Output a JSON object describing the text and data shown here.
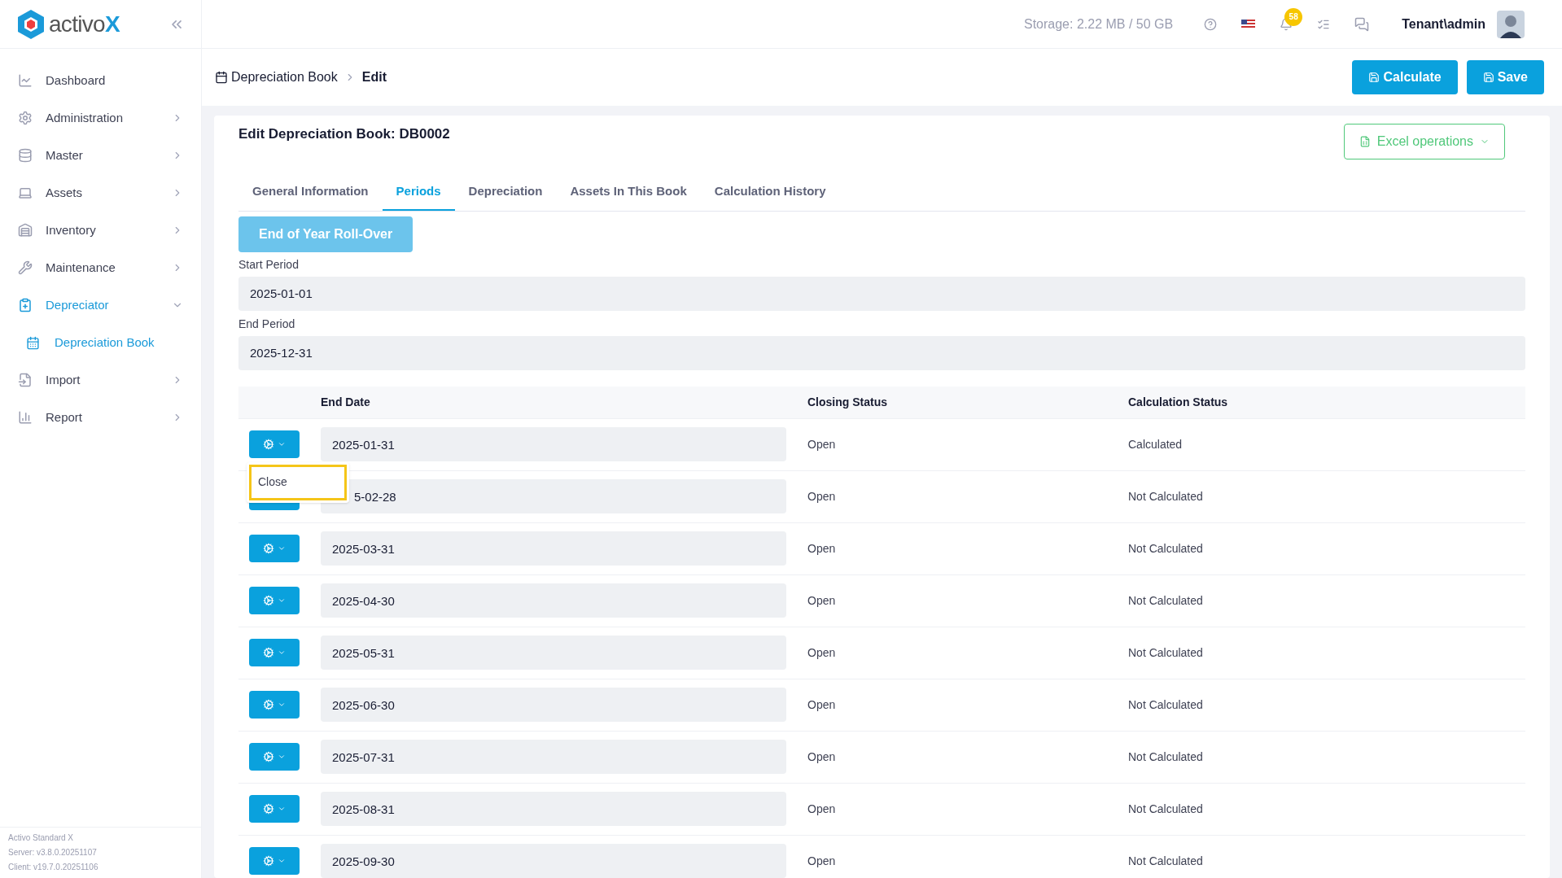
{
  "brand": {
    "name": "activo",
    "mark": "X"
  },
  "sidebar": {
    "items": [
      {
        "label": "Dashboard",
        "expanded": false,
        "has_children": false,
        "selected": false
      },
      {
        "label": "Administration",
        "expanded": false,
        "has_children": true,
        "selected": false
      },
      {
        "label": "Master",
        "expanded": false,
        "has_children": true,
        "selected": false
      },
      {
        "label": "Assets",
        "expanded": false,
        "has_children": true,
        "selected": false
      },
      {
        "label": "Inventory",
        "expanded": false,
        "has_children": true,
        "selected": false
      },
      {
        "label": "Maintenance",
        "expanded": false,
        "has_children": true,
        "selected": false
      },
      {
        "label": "Depreciator",
        "expanded": true,
        "has_children": true,
        "selected": true,
        "children": [
          {
            "label": "Depreciation Book",
            "selected": true
          }
        ]
      },
      {
        "label": "Import",
        "expanded": false,
        "has_children": true,
        "selected": false
      },
      {
        "label": "Report",
        "expanded": false,
        "has_children": true,
        "selected": false
      }
    ],
    "footer": [
      "Activo Standard X",
      "Server: v3.8.0.20251107",
      "Client: v19.7.0.20251106"
    ]
  },
  "topbar": {
    "storage": "Storage: 2.22 MB / 50 GB",
    "notifications": "58",
    "user": "Tenant\\admin"
  },
  "breadcrumb": [
    "Depreciation Book",
    "Edit"
  ],
  "actions": [
    "Calculate",
    "Save"
  ],
  "card": {
    "title": "Edit Depreciation Book: DB0002",
    "excel": "Excel operations",
    "tabs": [
      {
        "label": "General Information",
        "selected": false
      },
      {
        "label": "Periods",
        "selected": true
      },
      {
        "label": "Depreciation",
        "selected": false
      },
      {
        "label": "Assets In This Book",
        "selected": false
      },
      {
        "label": "Calculation History",
        "selected": false
      }
    ],
    "rollover": "End of Year Roll-Over",
    "start_label": "Start Period",
    "start": "2025-01-01",
    "end_label": "End Period",
    "end": "2025-12-31",
    "columns": [
      "End Date",
      "Closing Status",
      "Calculation Status"
    ],
    "rows": [
      {
        "date": "2025-01-31",
        "closing": "Open",
        "calc": "Calculated",
        "covered": false
      },
      {
        "date": "5-02-28",
        "closing": "Open",
        "calc": "Not Calculated",
        "covered": true
      },
      {
        "date": "2025-03-31",
        "closing": "Open",
        "calc": "Not Calculated",
        "covered": false
      },
      {
        "date": "2025-04-30",
        "closing": "Open",
        "calc": "Not Calculated",
        "covered": false
      },
      {
        "date": "2025-05-31",
        "closing": "Open",
        "calc": "Not Calculated",
        "covered": false
      },
      {
        "date": "2025-06-30",
        "closing": "Open",
        "calc": "Not Calculated",
        "covered": false
      },
      {
        "date": "2025-07-31",
        "closing": "Open",
        "calc": "Not Calculated",
        "covered": false
      },
      {
        "date": "2025-08-31",
        "closing": "Open",
        "calc": "Not Calculated",
        "covered": false
      },
      {
        "date": "2025-09-30",
        "closing": "Open",
        "calc": "Not Calculated",
        "covered": false
      }
    ],
    "menu": [
      "Close"
    ]
  }
}
